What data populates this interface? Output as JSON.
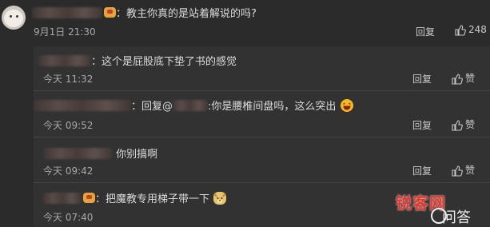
{
  "main_comment": {
    "text": "：教主你真的是站着解说的吗?",
    "date": "9月1日 21:30",
    "reply_label": "回复",
    "like_count": "248"
  },
  "replies": [
    {
      "prefix": "",
      "mention": "",
      "text": "：这个是屁股底下垫了书的感觉",
      "time": "今天 11:32",
      "reply_label": "回复",
      "like_label": "赞"
    },
    {
      "prefix": "：回复@",
      "mention": "",
      "text": ":你是腰椎间盘吗，这么突出",
      "time": "今天 09:52",
      "reply_label": "回复",
      "like_label": "赞"
    },
    {
      "prefix": "",
      "mention": "",
      "text": "你别搞啊",
      "time": "今天 09:42",
      "reply_label": "回复",
      "like_label": "赞"
    },
    {
      "prefix": "",
      "mention": "",
      "text": "：把魔教专用梯子带一下",
      "time": "今天 07:40",
      "reply_label": "回复",
      "like_label": "赞"
    }
  ],
  "watermark": {
    "brand": "锐客网",
    "suffix": "问答"
  },
  "icons": {
    "avatar": "cat-avatar-icon",
    "badge": "vip-badge-icon",
    "thumb": "thumbs-up-icon",
    "emoji_laugh": "laughing-emoji-icon",
    "emoji_doge": "doge-emoji-icon"
  }
}
